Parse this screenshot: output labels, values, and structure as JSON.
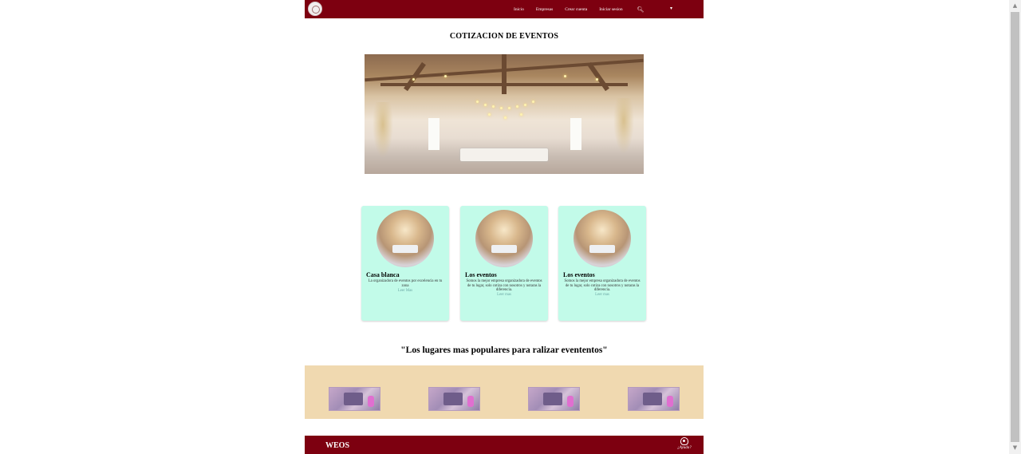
{
  "nav": {
    "links": [
      "Inicio",
      "Empresas",
      "Crear cuenta",
      "Iniciar sesion"
    ],
    "search_icon": "search-icon",
    "caret_icon": "caret-down-icon"
  },
  "page_title": "COTIZACION DE EVENTOS",
  "cards": [
    {
      "title": "Casa blanca",
      "text": "La organizadora de eventos por excelencia en tu zona",
      "link": "Leer Mas"
    },
    {
      "title": "Los eventos",
      "text": "Somos la mejor empresa organizadora de eventos de tu lugar, solo cotiza con nosotros y notaras la diferencia.",
      "link": "Leer mas"
    },
    {
      "title": "Los eventos",
      "text": "Somos la mejor empresa organizadora de eventos de tu lugar, solo cotiza con nosotros y notaras la diferencia.",
      "link": "Leer mas"
    }
  ],
  "popular_title": "\"Los lugares mas populares para ralizar evententos\"",
  "footer": {
    "brand": "WEOS",
    "help_label": "¿Ayuda?"
  },
  "colors": {
    "brand": "#7d0010",
    "card_bg": "#c2fbe9",
    "gallery_bg": "#f0d9b0"
  }
}
